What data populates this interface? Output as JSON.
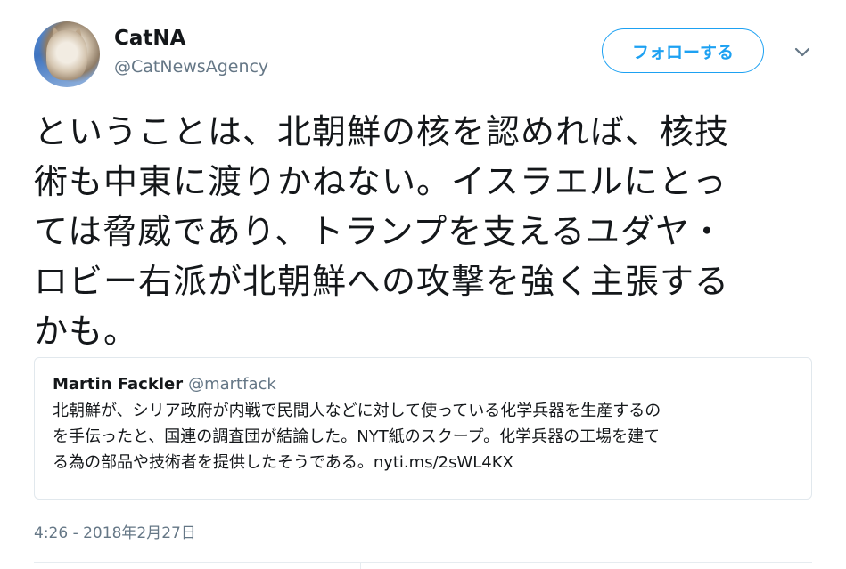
{
  "author": {
    "name": "CatNA",
    "handle": "@CatNewsAgency"
  },
  "follow_label": "フォローする",
  "tweet": {
    "lines": [
      "ということは、北朝鮮の核を認めれば、核技",
      "術も中東に渡りかねない。イスラエルにとっ",
      "ては脅威であり、トランプを支えるユダヤ・",
      "ロビー右派が北朝鮮への攻撃を強く主張する",
      "かも。"
    ]
  },
  "quote": {
    "name": "Martin Fackler",
    "handle": "@martfack",
    "lines": [
      "北朝鮮が、シリア政府が内戦で民間人などに対して使っている化学兵器を生産するの",
      "を手伝ったと、国連の調査団が結論した。NYT紙のスクープ。化学兵器の工場を建て",
      "る為の部品や技術者を提供したそうである。nyti.ms/2sWL4KX"
    ]
  },
  "timestamp": "4:26 - 2018年2月27日",
  "colors": {
    "accent": "#1da1f2",
    "text": "#14171a",
    "secondary": "#657786",
    "border": "#e1e8ed"
  },
  "icons": {
    "menu": "chevron-down-icon"
  }
}
